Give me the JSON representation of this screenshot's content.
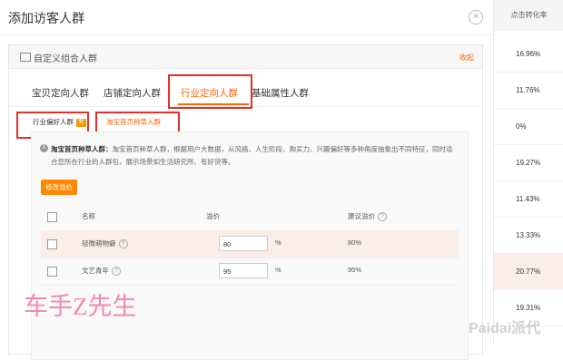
{
  "background_table": {
    "header": "点击转化率",
    "values": [
      "16.96%",
      "11.76%",
      "0%",
      "19.27%",
      "11.43%",
      "13.33%",
      "20.77%",
      "19.31%"
    ]
  },
  "modal": {
    "title": "添加访客人群",
    "close_label": "×",
    "panel": {
      "title": "自定义组合人群",
      "collapse_label": "收起",
      "tabs": [
        {
          "label": "宝贝定向人群"
        },
        {
          "label": "店铺定向人群"
        },
        {
          "label": "行业定向人群"
        },
        {
          "label": "基础属性人群"
        }
      ],
      "subtabs": [
        {
          "label": "行业偏好人群",
          "badge": "新"
        },
        {
          "label": "淘宝首页种草人群"
        }
      ],
      "info": {
        "bold": "淘宝首页种草人群：",
        "text": "淘宝首页种草人群，根据用户大数据，从风格、人生阶段、购买力、兴趣偏好等多种角度抽象出不同特征，同时适合您所在行业的人群包，展示场景如生活研究所、有好货等。"
      },
      "modify_button": "修改溢价",
      "table": {
        "headers": {
          "name": "名称",
          "premium": "溢价",
          "suggested": "建议溢价"
        },
        "rows": [
          {
            "name": "轻微萌物癖",
            "premium": "80",
            "unit": "%",
            "suggested": "80%"
          },
          {
            "name": "文艺青年",
            "premium": "95",
            "unit": "%",
            "suggested": "95%"
          }
        ]
      }
    }
  },
  "watermark_text": "车手Z先生",
  "logo_text": "Paidai派代"
}
